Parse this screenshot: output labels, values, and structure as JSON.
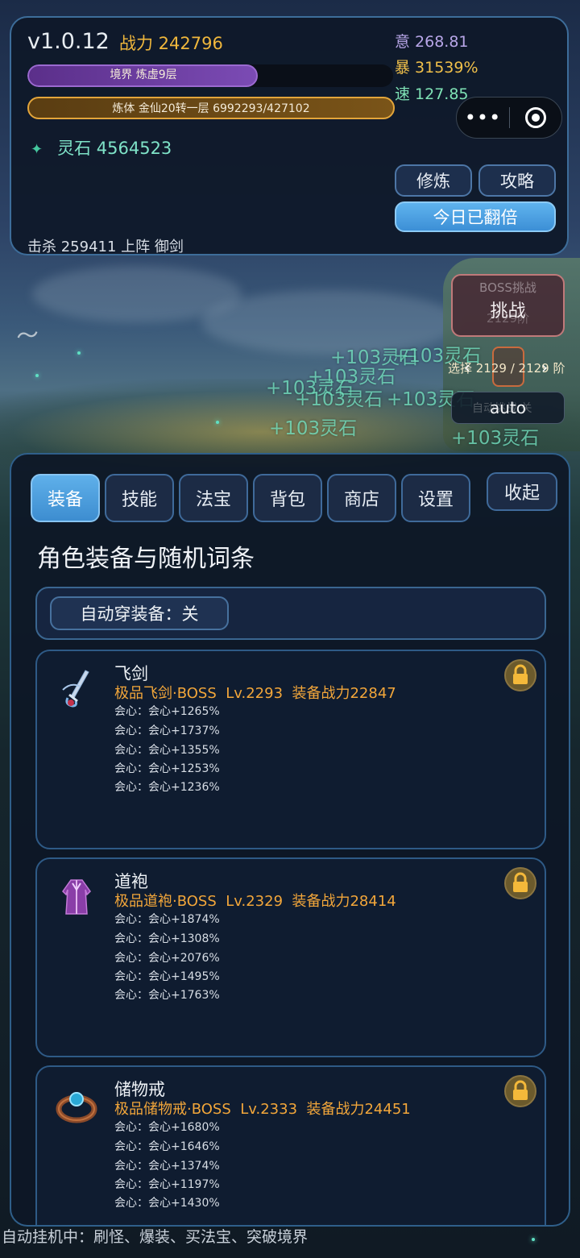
{
  "header": {
    "version": "v1.0.12",
    "power_label": "战力 242796",
    "yi": "意 268.81",
    "bao": "暴 31539%",
    "su": "速 127.85",
    "realm_text": "境界 炼虚9层",
    "realm_progress": 0.63,
    "body_text": "炼体 金仙20转一层  6992293/427102",
    "spirit_stones": "灵石 4564523",
    "kills": "击杀 259411  上阵 御剑",
    "btn_cultivate": "修炼",
    "btn_guide": "攻略",
    "btn_double": "今日已翻倍",
    "capsule_more": "•••"
  },
  "boss": {
    "ghost_top": "BOSS挑战",
    "label": "挑战",
    "ghost_bottom": "2129阶",
    "stage_text": "选择 2129 / 2129 阶",
    "prev": "‹",
    "next": "›",
    "auto": "auto",
    "auto_ghost": "自动挑战 关"
  },
  "floating": {
    "t1": "+103灵石",
    "t2": "+103灵石",
    "t3": "+103灵石",
    "t4": "+103灵石",
    "t5": "+103灵石",
    "t6": "+103灵石",
    "t7": "+103灵石",
    "t8": "+103灵石"
  },
  "tabs": {
    "equip": "装备",
    "skill": "技能",
    "treasure": "法宝",
    "bag": "背包",
    "shop": "商店",
    "settings": "设置",
    "collapse": "收起"
  },
  "section_title": "角色装备与随机词条",
  "auto_wear": "自动穿装备：关",
  "items": [
    {
      "name": "飞剑",
      "sub": "极品飞剑·BOSS  Lv.2293  装备战力22847",
      "affixes": [
        "会心：会心+1265%",
        "会心：会心+1737%",
        "会心：会心+1355%",
        "会心：会心+1253%",
        "会心：会心+1236%"
      ]
    },
    {
      "name": "道袍",
      "sub": "极品道袍·BOSS  Lv.2329  装备战力28414",
      "affixes": [
        "会心：会心+1874%",
        "会心：会心+1308%",
        "会心：会心+2076%",
        "会心：会心+1495%",
        "会心：会心+1763%"
      ]
    },
    {
      "name": "储物戒",
      "sub": "极品储物戒·BOSS  Lv.2333  装备战力24451",
      "affixes": [
        "会心：会心+1680%",
        "会心：会心+1646%",
        "会心：会心+1374%",
        "会心：会心+1197%",
        "会心：会心+1430%"
      ]
    }
  ],
  "footer": "自动挂机中：刷怪、爆装、买法宝、突破境界",
  "icons": {
    "gem": "spirit-stone-icon",
    "sword": "flying-sword-icon",
    "robe": "robe-icon",
    "ring": "ring-icon",
    "lock": "lock-icon"
  },
  "colors": {
    "accent_blue": "#4a9fe0",
    "gold": "#f0b73c",
    "item_orange": "#f2a63a",
    "spirit_green": "#7fe3c8"
  }
}
